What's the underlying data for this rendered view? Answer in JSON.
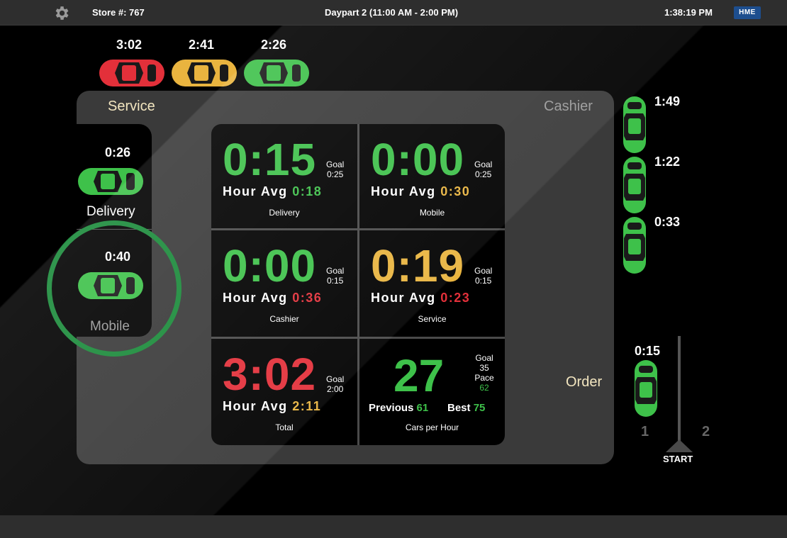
{
  "header": {
    "store": "Store #: 767",
    "daypart": "Daypart 2 (11:00 AM - 2:00 PM)",
    "clock": "1:38:19 PM",
    "logo": "HME",
    "settings_icon": "gear-icon"
  },
  "queue_top": [
    {
      "time": "3:02",
      "color": "#e3303a"
    },
    {
      "time": "2:41",
      "color": "#e9b43f"
    },
    {
      "time": "2:26",
      "color": "#3ec14a"
    }
  ],
  "lanes": {
    "service_label": "Service",
    "cashier_label": "Cashier",
    "order_label": "Order"
  },
  "side": {
    "delivery": {
      "time": "0:26",
      "label": "Delivery"
    },
    "mobile": {
      "time": "0:40",
      "label": "Mobile"
    }
  },
  "cashier_queue": [
    {
      "time": "1:49"
    },
    {
      "time": "1:22"
    },
    {
      "time": "0:33"
    }
  ],
  "order_point": {
    "time": "0:15",
    "start_label": "START",
    "lane1": "1",
    "lane2": "2"
  },
  "tiles": [
    {
      "value": "0:15",
      "goal_label": "Goal",
      "goal": "0:25",
      "avg_label": "Hour Avg",
      "avg": "0:18",
      "name": "Delivery",
      "value_color": "green",
      "avg_color": "green"
    },
    {
      "value": "0:00",
      "goal_label": "Goal",
      "goal": "0:25",
      "avg_label": "Hour Avg",
      "avg": "0:30",
      "name": "Mobile",
      "value_color": "green",
      "avg_color": "yellow"
    },
    {
      "value": "0:00",
      "goal_label": "Goal",
      "goal": "0:15",
      "avg_label": "Hour Avg",
      "avg": "0:36",
      "name": "Cashier",
      "value_color": "green",
      "avg_color": "red"
    },
    {
      "value": "0:19",
      "goal_label": "Goal",
      "goal": "0:15",
      "avg_label": "Hour Avg",
      "avg": "0:23",
      "name": "Service",
      "value_color": "yellow",
      "avg_color": "red"
    },
    {
      "value": "3:02",
      "goal_label": "Goal",
      "goal": "2:00",
      "avg_label": "Hour Avg",
      "avg": "2:11",
      "name": "Total",
      "value_color": "red",
      "avg_color": "yellow"
    }
  ],
  "cars_per_hour": {
    "value": "27",
    "goal_label": "Goal",
    "goal": "35",
    "pace_label": "Pace",
    "pace": "62",
    "previous_label": "Previous",
    "previous": "61",
    "best_label": "Best",
    "best": "75",
    "name": "Cars per Hour"
  }
}
